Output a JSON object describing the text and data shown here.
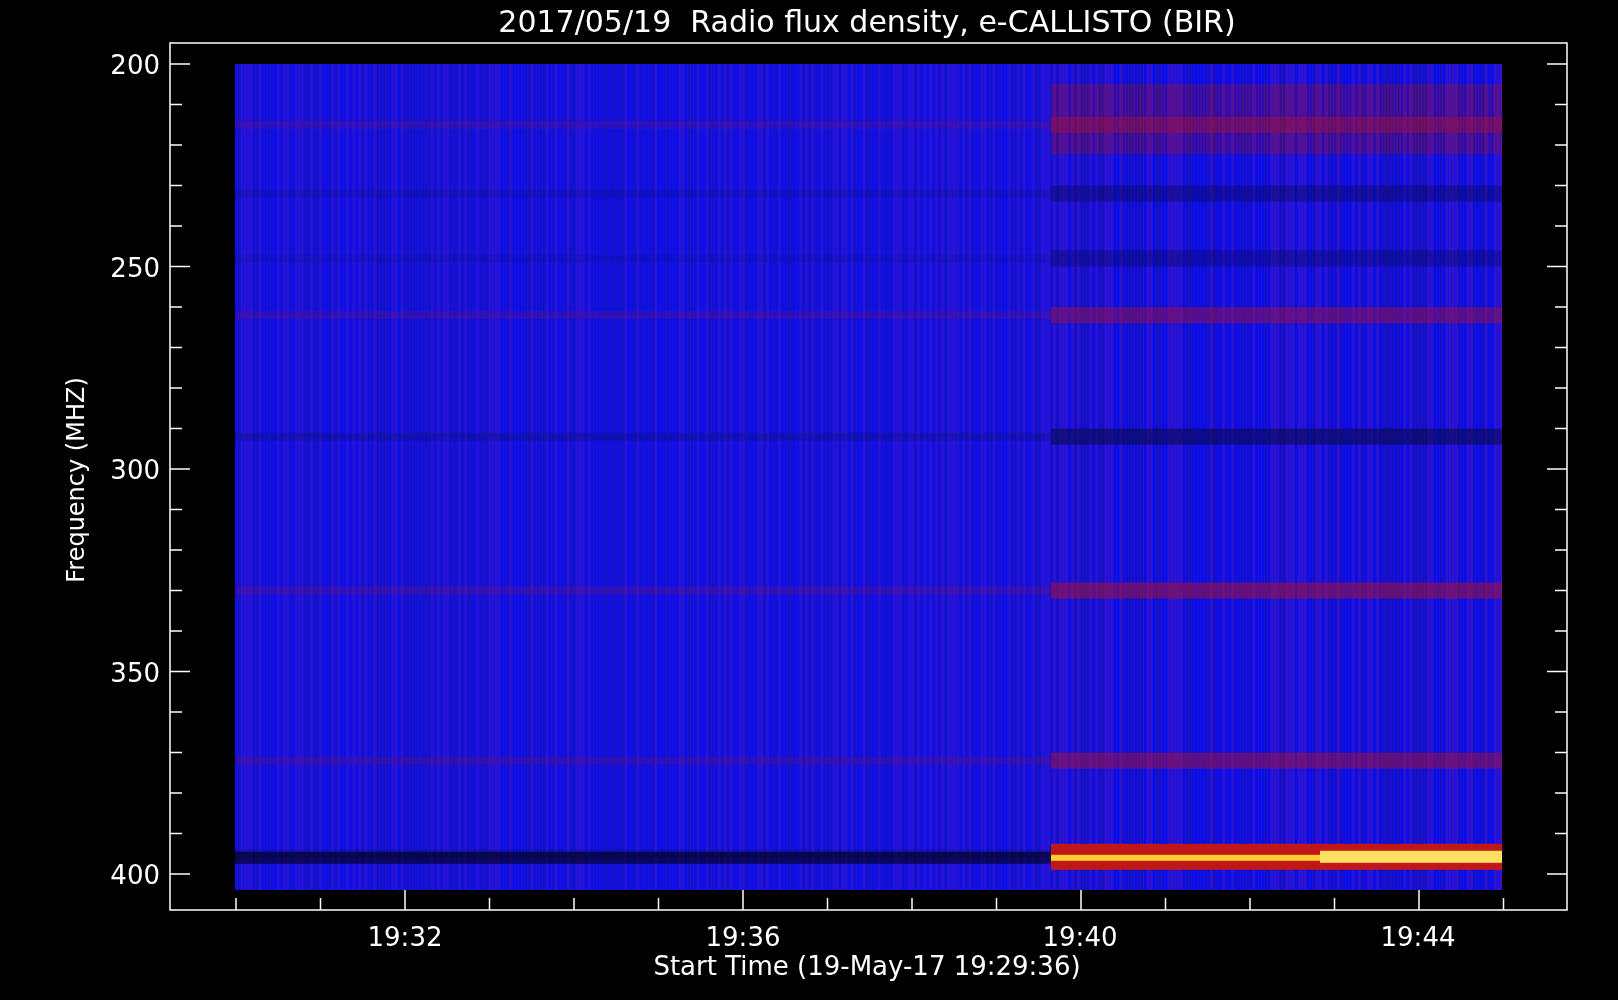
{
  "title": "2017/05/19  Radio flux density, e-CALLISTO (BIR)",
  "y_axis": {
    "label": "Frequency (MHZ)",
    "ticks": [
      "200",
      "250",
      "300",
      "350",
      "400"
    ]
  },
  "x_axis": {
    "label": "Start Time (19-May-17 19:29:36)",
    "ticks": [
      "19:32",
      "19:36",
      "19:40",
      "19:44"
    ]
  }
}
